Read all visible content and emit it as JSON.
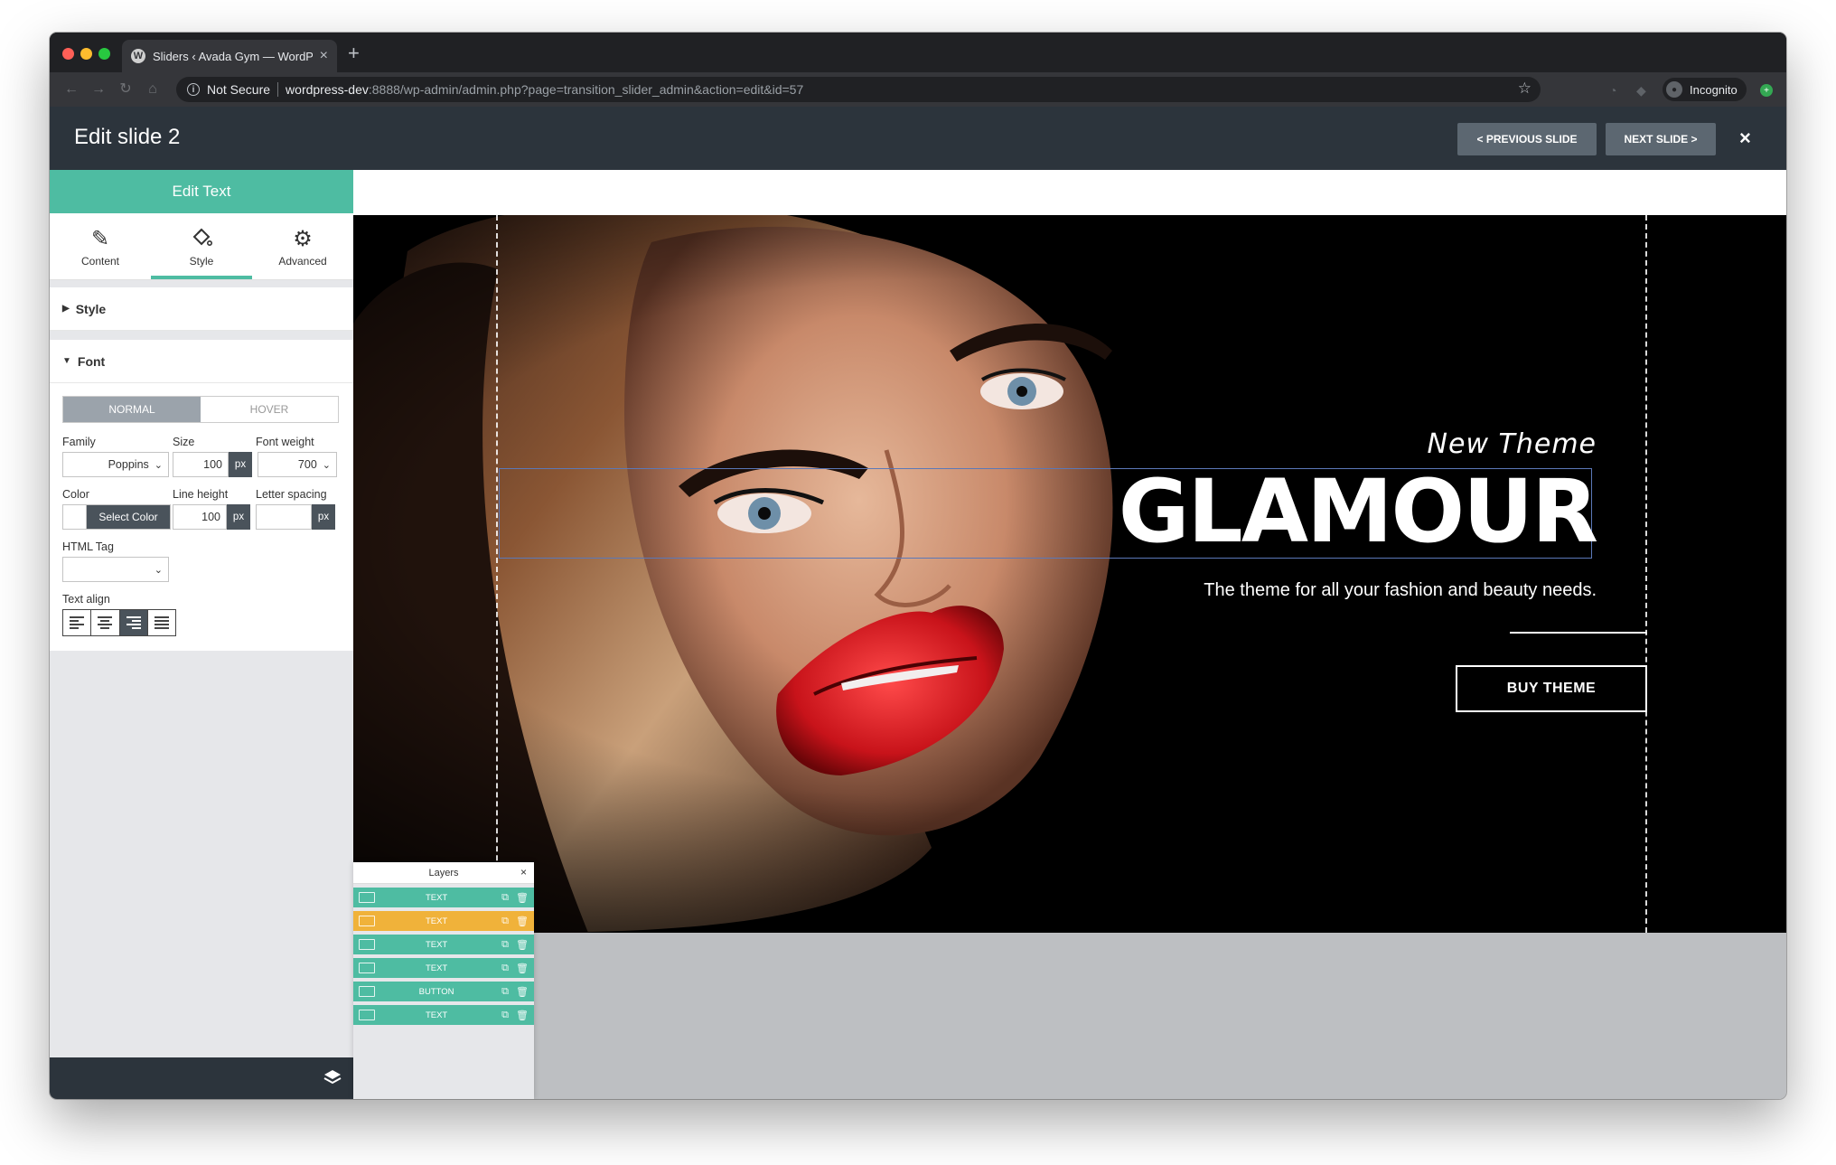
{
  "browser": {
    "tab_title": "Sliders ‹ Avada Gym — WordP",
    "tab_favicon": "W",
    "tab_close": "×",
    "new_tab": "+",
    "security_label": "Not Secure",
    "url_host": "wordpress-dev",
    "url_path": ":8888/wp-admin/admin.php?page=transition_slider_admin&action=edit&id=57",
    "profile_label": "Incognito",
    "icons": [
      "back-icon",
      "forward-icon",
      "reload-icon",
      "home-icon",
      "info-icon",
      "star-icon",
      "extension-icon",
      "incognito-icon"
    ]
  },
  "editor": {
    "title": "Edit slide 2",
    "prev_label": "< PREVIOUS SLIDE",
    "next_label": "NEXT SLIDE >",
    "close_label": "×"
  },
  "panel": {
    "header": "Edit Text",
    "tabs": [
      {
        "label": "Content",
        "icon": "pencil-icon"
      },
      {
        "label": "Style",
        "icon": "paint-bucket-icon"
      },
      {
        "label": "Advanced",
        "icon": "gear-icon"
      }
    ],
    "active_tab": "Style",
    "sections": {
      "style": "Style",
      "font": "Font"
    },
    "states": {
      "normal": "NORMAL",
      "hover": "HOVER"
    },
    "labels": {
      "family": "Family",
      "size": "Size",
      "weight": "Font weight",
      "color": "Color",
      "line_height": "Line height",
      "letter_spacing": "Letter spacing",
      "html_tag": "HTML Tag",
      "text_align": "Text align"
    },
    "values": {
      "family": "Poppins",
      "size": "100",
      "size_unit": "px",
      "weight": "700",
      "color_button": "Select Color",
      "line_height": "100",
      "line_height_unit": "px",
      "letter_spacing": "",
      "letter_spacing_unit": "px",
      "html_tag": ""
    },
    "active_align": "right"
  },
  "slide": {
    "subtitle": "New Theme",
    "headline": "GLAMOUR",
    "tagline": "The theme for all your fashion and beauty needs.",
    "button": "BUY THEME"
  },
  "layers": {
    "title": "Layers",
    "close": "×",
    "items": [
      {
        "label": "TEXT",
        "color": "#4ebca2"
      },
      {
        "label": "TEXT",
        "color": "#f0b23a"
      },
      {
        "label": "TEXT",
        "color": "#4ebca2"
      },
      {
        "label": "TEXT",
        "color": "#4ebca2"
      },
      {
        "label": "BUTTON",
        "color": "#4ebca2"
      },
      {
        "label": "TEXT",
        "color": "#4ebca2"
      }
    ]
  },
  "colors": {
    "accent": "#4ebca2",
    "header_bg": "#2c343c",
    "selected_layer": "#f0b23a",
    "lip_red": "#c8131a"
  }
}
